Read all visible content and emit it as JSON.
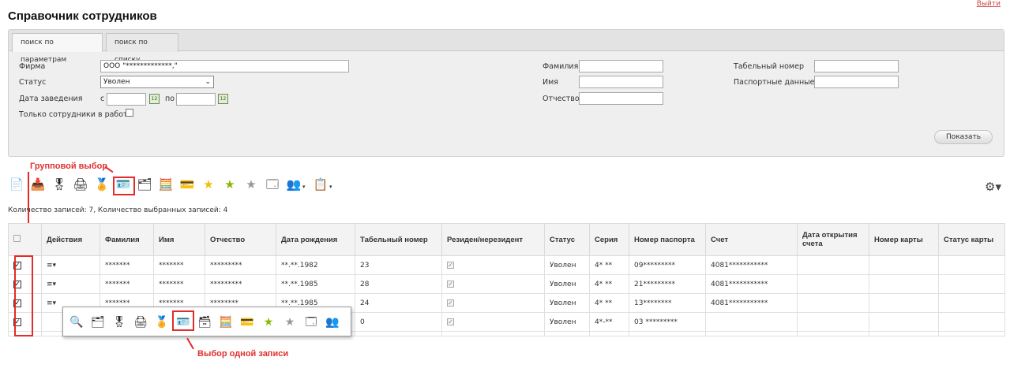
{
  "page": {
    "title": "Справочник сотрудников",
    "corner_link": "Выйти"
  },
  "tabs": [
    {
      "label": "поиск по параметрам",
      "active": true
    },
    {
      "label": "поиск по списку",
      "active": false
    }
  ],
  "filters": {
    "firm_label": "Фирма",
    "firm_value": "ООО \"*************,\"",
    "status_label": "Статус",
    "status_value": "Уволен",
    "date_label": "Дата заведения",
    "date_from_label": "с",
    "date_to_label": "по",
    "only_working_label": "Только сотрудники в работе",
    "lastname_label": "Фамилия",
    "firstname_label": "Имя",
    "patronymic_label": "Отчество",
    "tabnum_label": "Табельный номер",
    "passport_label": "Паспортные данные",
    "show_button": "Показать"
  },
  "annotations": {
    "group_select": "Групповой выбор",
    "single_select": "Выбор одной записи"
  },
  "counts_text": "Количество записей: 7, Количество выбранных записей: 4",
  "table": {
    "headers": [
      "Действия",
      "Фамилия",
      "Имя",
      "Отчество",
      "Дата рождения",
      "Табельный номер",
      "Резиден/нерезидент",
      "Статус",
      "Серия",
      "Номер паспорта",
      "Счет",
      "Дата открытия счета",
      "Номер карты",
      "Статус карты"
    ],
    "rows": [
      {
        "actions": "≡▾",
        "lastname": "*******",
        "firstname": "*******",
        "patronymic": "*********",
        "birth": "**.**.1982",
        "tabnum": "23",
        "status": "Уволен",
        "series": "4* **",
        "passport": "09*********",
        "account": "4081***********"
      },
      {
        "actions": "≡▾",
        "lastname": "*******",
        "firstname": "*******",
        "patronymic": "*********",
        "birth": "**.**.1985",
        "tabnum": "28",
        "status": "Уволен",
        "series": "4* **",
        "passport": "21*********",
        "account": "4081***********"
      },
      {
        "actions": "≡▾",
        "lastname": "*******",
        "firstname": "*******",
        "patronymic": "********",
        "birth": "**.**.1985",
        "tabnum": "24",
        "status": "Уволен",
        "series": "4* **",
        "passport": "13********",
        "account": "4081***********"
      },
      {
        "actions": "",
        "lastname": "",
        "firstname": "",
        "patronymic": "",
        "birth": "",
        "tabnum": "0",
        "status": "Уволен",
        "series": "4*-**",
        "passport": "03 *********",
        "account": ""
      }
    ]
  }
}
